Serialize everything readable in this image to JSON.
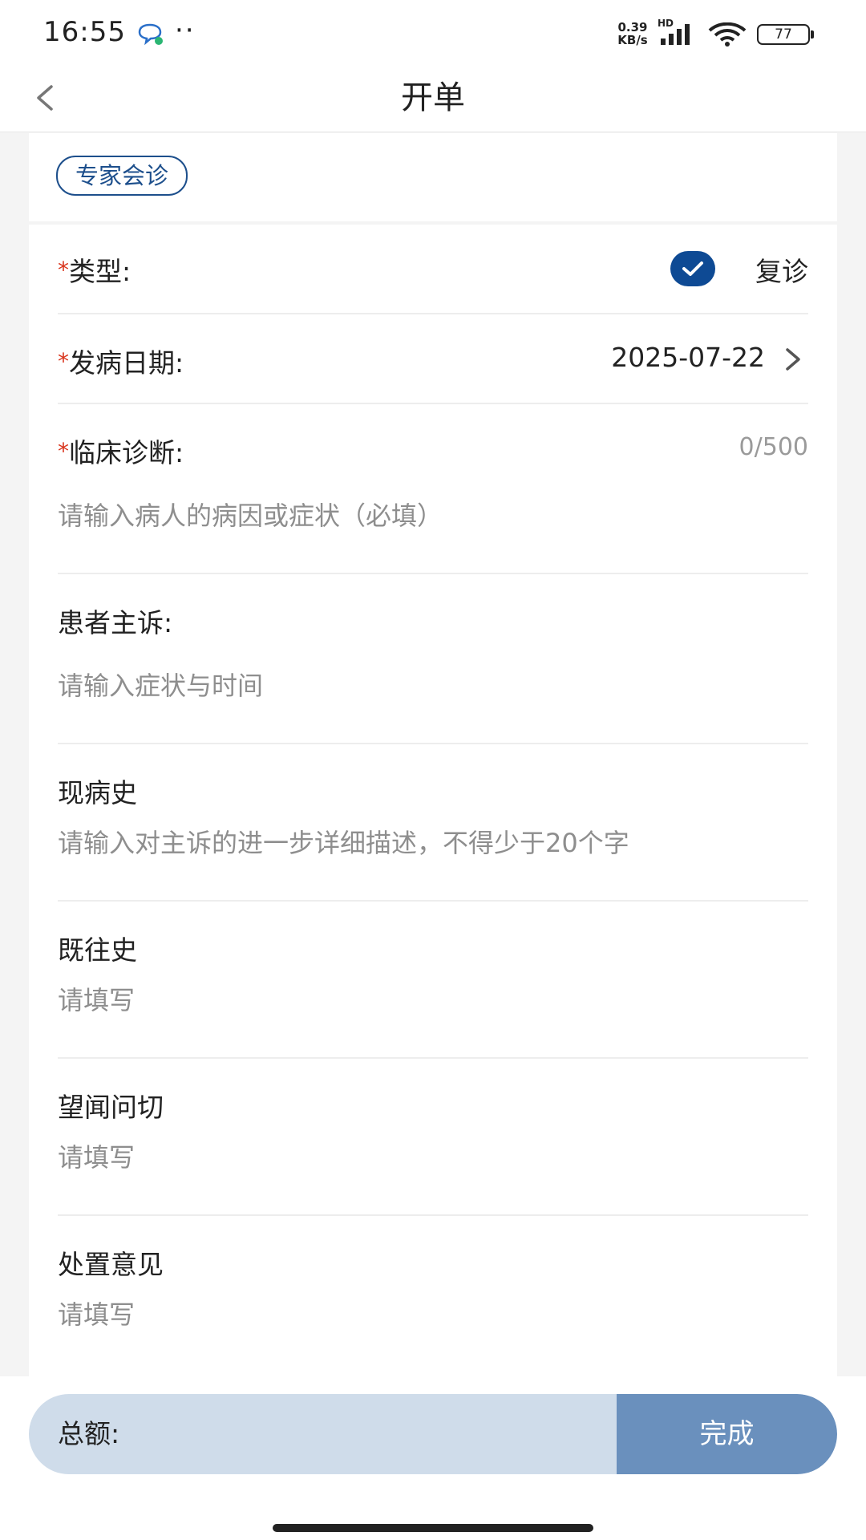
{
  "status_bar": {
    "time": "16:55",
    "dots": "··",
    "net_speed_value": "0.39",
    "net_speed_unit": "KB/s",
    "network_badge": "HD",
    "battery": "77"
  },
  "header": {
    "title": "开单"
  },
  "tag": {
    "label": "专家会诊"
  },
  "form": {
    "required_mark": "*",
    "type": {
      "label": "类型:",
      "value": "复诊",
      "checked": true
    },
    "onset_date": {
      "label": "发病日期:",
      "value": "2025-07-22"
    },
    "diagnosis": {
      "label": "临床诊断:",
      "counter": "0/500",
      "placeholder": "请输入病人的病因或症状（必填）"
    },
    "chief_complaint": {
      "label": "患者主诉:",
      "placeholder": "请输入症状与时间"
    },
    "present_history": {
      "label": "现病史",
      "placeholder": "请输入对主诉的进一步详细描述，不得少于20个字"
    },
    "past_history": {
      "label": "既往史",
      "placeholder": "请填写"
    },
    "tcm_exam": {
      "label": "望闻问切",
      "placeholder": "请填写"
    },
    "treatment": {
      "label": "处置意见",
      "placeholder": "请填写"
    }
  },
  "footer": {
    "total_label": "总额:",
    "done_label": "完成"
  },
  "colors": {
    "primary": "#0e4a94",
    "tag_border": "#1d4f8c",
    "required": "#d9361e",
    "total_bar": "#cfdcea",
    "done_button": "#6a90bd"
  }
}
